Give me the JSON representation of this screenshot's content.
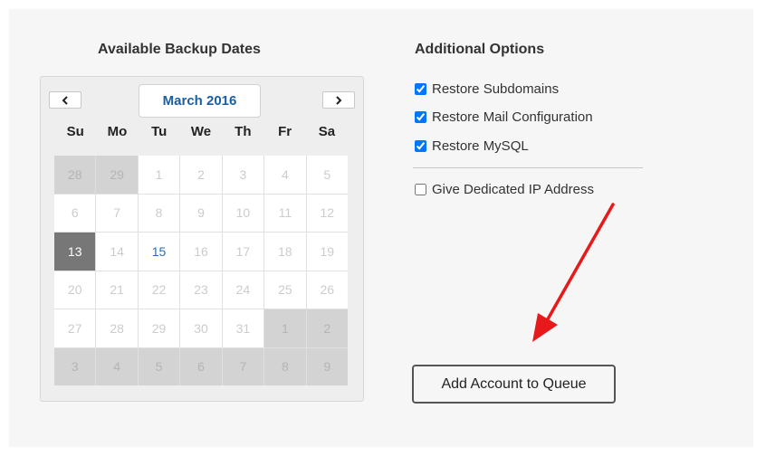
{
  "backup": {
    "title": "Available Backup Dates",
    "calendar": {
      "month": "March 2016",
      "prev_icon": "chevron-left-icon",
      "next_icon": "chevron-right-icon",
      "weekdays": [
        "Su",
        "Mo",
        "Tu",
        "We",
        "Th",
        "Fr",
        "Sa"
      ],
      "selected_day": "13",
      "available_day": "15",
      "days": [
        [
          "28",
          "29",
          "1",
          "2",
          "3",
          "4",
          "5"
        ],
        [
          "6",
          "7",
          "8",
          "9",
          "10",
          "11",
          "12"
        ],
        [
          "13",
          "14",
          "15",
          "16",
          "17",
          "18",
          "19"
        ],
        [
          "20",
          "21",
          "22",
          "23",
          "24",
          "25",
          "26"
        ],
        [
          "27",
          "28",
          "29",
          "30",
          "31",
          "1",
          "2"
        ],
        [
          "3",
          "4",
          "5",
          "6",
          "7",
          "8",
          "9"
        ]
      ]
    }
  },
  "options": {
    "title": "Additional Options",
    "items": [
      {
        "label": "Restore Subdomains",
        "checked": true
      },
      {
        "label": "Restore Mail Configuration",
        "checked": true
      },
      {
        "label": "Restore MySQL",
        "checked": true
      },
      {
        "label": "Give Dedicated IP Address",
        "checked": false
      }
    ]
  },
  "action": {
    "button_label": "Add Account to Queue"
  },
  "colors": {
    "link_blue": "#1f6fc4",
    "selected_gray": "#777777",
    "arrow_red": "#e8191b"
  }
}
